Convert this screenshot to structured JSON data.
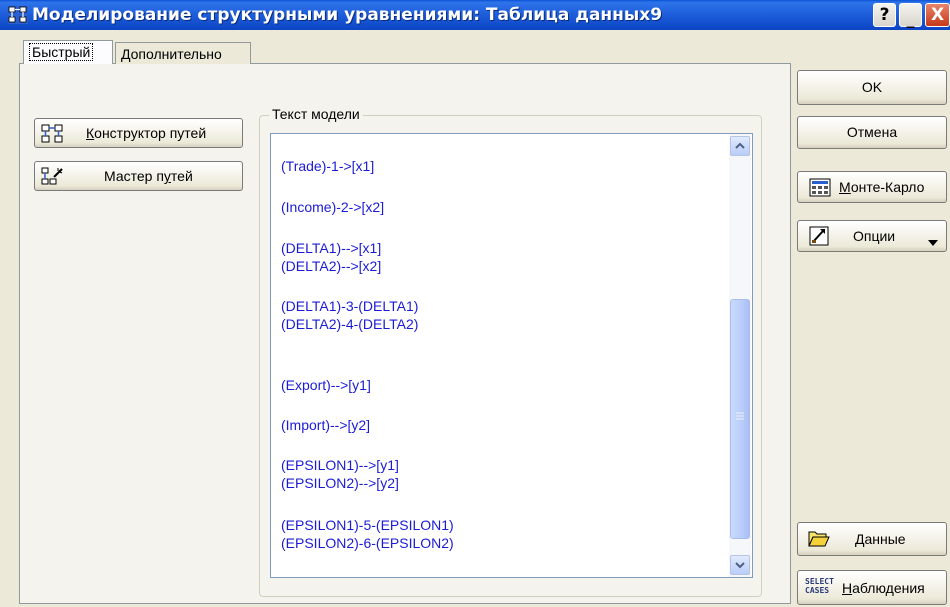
{
  "window": {
    "title": "Моделирование структурными уравнениями: Таблица данных9",
    "help_label": "?",
    "minimize_label": "_",
    "close_label": "X"
  },
  "tabs": [
    {
      "label": "Быстрый",
      "active": true
    },
    {
      "label": "Дополнительно",
      "active": false
    }
  ],
  "left_buttons": {
    "path_constructor": {
      "pre": "",
      "accel": "К",
      "post": "онструктор путей"
    },
    "path_wizard": {
      "pre": "Мастер п",
      "accel": "у",
      "post": "тей"
    }
  },
  "model_text": {
    "group_label": "Текст модели",
    "lines": [
      "(Trade)-1->[x1]",
      "(Income)-2->[x2]",
      "(DELTA1)-->[x1]",
      "(DELTA2)-->[x2]",
      "(DELTA1)-3-(DELTA1)",
      "(DELTA2)-4-(DELTA2)",
      "(Export)-->[y1]",
      "(Import)-->[y2]",
      "(EPSILON1)-->[y1]",
      "(EPSILON2)-->[y2]",
      "(EPSILON1)-5-(EPSILON1)",
      "(EPSILON2)-6-(EPSILON2)"
    ]
  },
  "right_buttons": {
    "ok": "OK",
    "cancel": "Отмена",
    "monte_carlo": {
      "accel": "М",
      "post": "онте-Карло"
    },
    "options": "Опции",
    "data": {
      "accel": "Д",
      "post": "анные"
    },
    "cases": {
      "accel": "Н",
      "post": "аблюдения"
    },
    "cases_icon_text": [
      "SELECT",
      "CASES"
    ]
  },
  "colors": {
    "title_bar": "#1f5fdc",
    "model_text": "#1b1bd6",
    "face": "#ece9d8"
  },
  "icons": [
    "app-icon",
    "path-diagram-icon",
    "path-wizard-icon",
    "scroll-up-icon",
    "scroll-down-icon",
    "calculator-icon",
    "options-icon",
    "dropdown-arrow-icon",
    "open-folder-icon",
    "select-cases-icon"
  ]
}
